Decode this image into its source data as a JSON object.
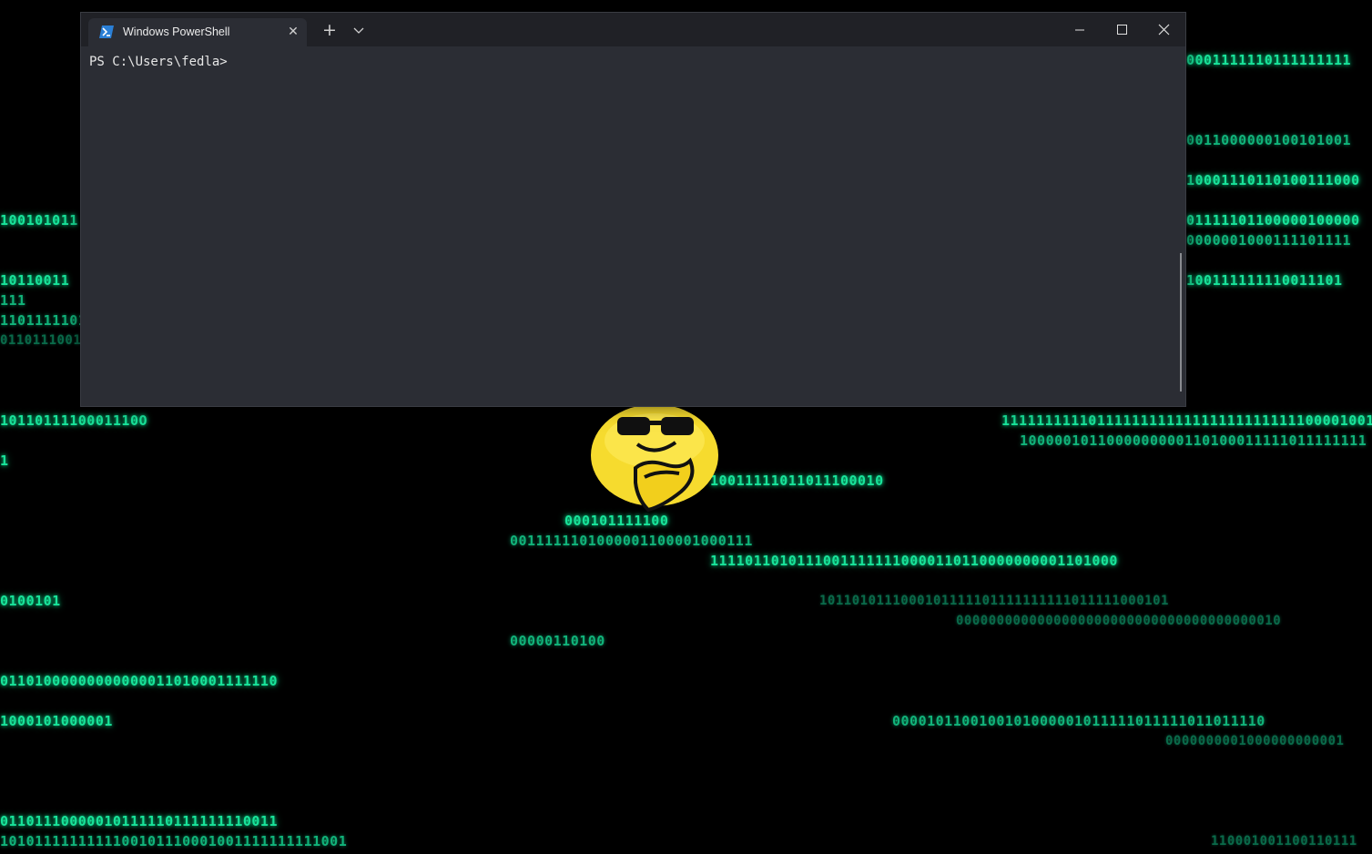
{
  "window": {
    "tab_title": "Windows PowerShell",
    "tab_icon": "powershell-icon",
    "new_tab_icon": "plus-icon",
    "dropdown_icon": "chevron-down-icon",
    "minimize_icon": "minimize-icon",
    "maximize_icon": "maximize-icon",
    "close_icon": "close-icon",
    "tab_close_icon": "close-icon",
    "tab_close_glyph": "✕",
    "new_tab_glyph": "+"
  },
  "terminal": {
    "prompt": "PS C:\\Users\\fedla>"
  },
  "wallpaper": {
    "mascot": "sunglasses-emoji-mascot",
    "binary_rows": [
      "100101011",
      "10110011",
      "111",
      "1101111101",
      "0110111001",
      "1011011110001110O",
      "1",
      "0100101",
      "01101000000000000011010001111110",
      "1000101000001",
      "01101110000010111110111111110011",
      "1010111111111100101110001001111111111001",
      "10011111011011100010",
      "000101111100",
      "0011111101000001100001000111",
      "11110110101110011111110000110110000000001101000",
      "00000110100",
      "11111111110111111111111111111111111000010011",
      "1000001011000000000110100011111011111111",
      "0001111110111111111",
      "0011000000100101001",
      "10001110110100111000",
      "01111101100000100000",
      "0000001000111101111",
      "100111111110011101",
      "1011010111000101111101111111111011111000101",
      "0000000000000000000000000000000000000010",
      "0000101100100101000001011111011111011011110",
      "0000000001000000000001",
      "110001001100110111"
    ]
  }
}
